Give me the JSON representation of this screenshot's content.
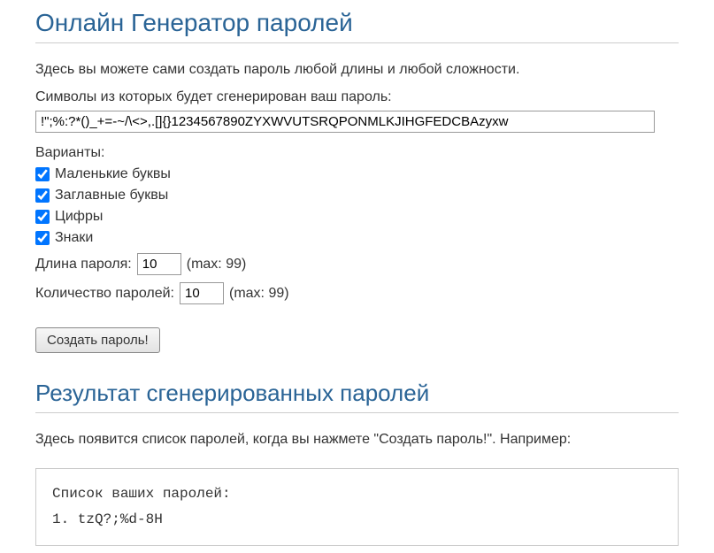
{
  "header": {
    "title": "Онлайн Генератор паролей"
  },
  "intro": {
    "description": "Здесь вы можете сами создать пароль любой длины и любой сложности.",
    "symbols_label": "Символы из которых будет сгенерирован ваш пароль:",
    "symbols_value": "!\";%:?*()_+=-~/\\<>,.[]{}1234567890ZYXWVUTSRQPONMLKJIHGFEDCBAzyxw"
  },
  "options": {
    "variants_label": "Варианты:",
    "lowercase": {
      "label": "Маленькие буквы",
      "checked": true
    },
    "uppercase": {
      "label": "Заглавные буквы",
      "checked": true
    },
    "digits": {
      "label": "Цифры",
      "checked": true
    },
    "symbols": {
      "label": "Знаки",
      "checked": true
    }
  },
  "length": {
    "label": "Длина пароля:",
    "value": "10",
    "max_hint": "(max: 99)"
  },
  "count": {
    "label": "Количество паролей:",
    "value": "10",
    "max_hint": "(max: 99)"
  },
  "button": {
    "create_label": "Создать пароль!"
  },
  "result": {
    "heading": "Результат сгенерированных паролей",
    "description": "Здесь появится список паролей, когда вы нажмете \"Создать пароль!\". Например:",
    "list_title": "Список ваших паролей:",
    "item1": "1. tzQ?;%d-8H"
  }
}
